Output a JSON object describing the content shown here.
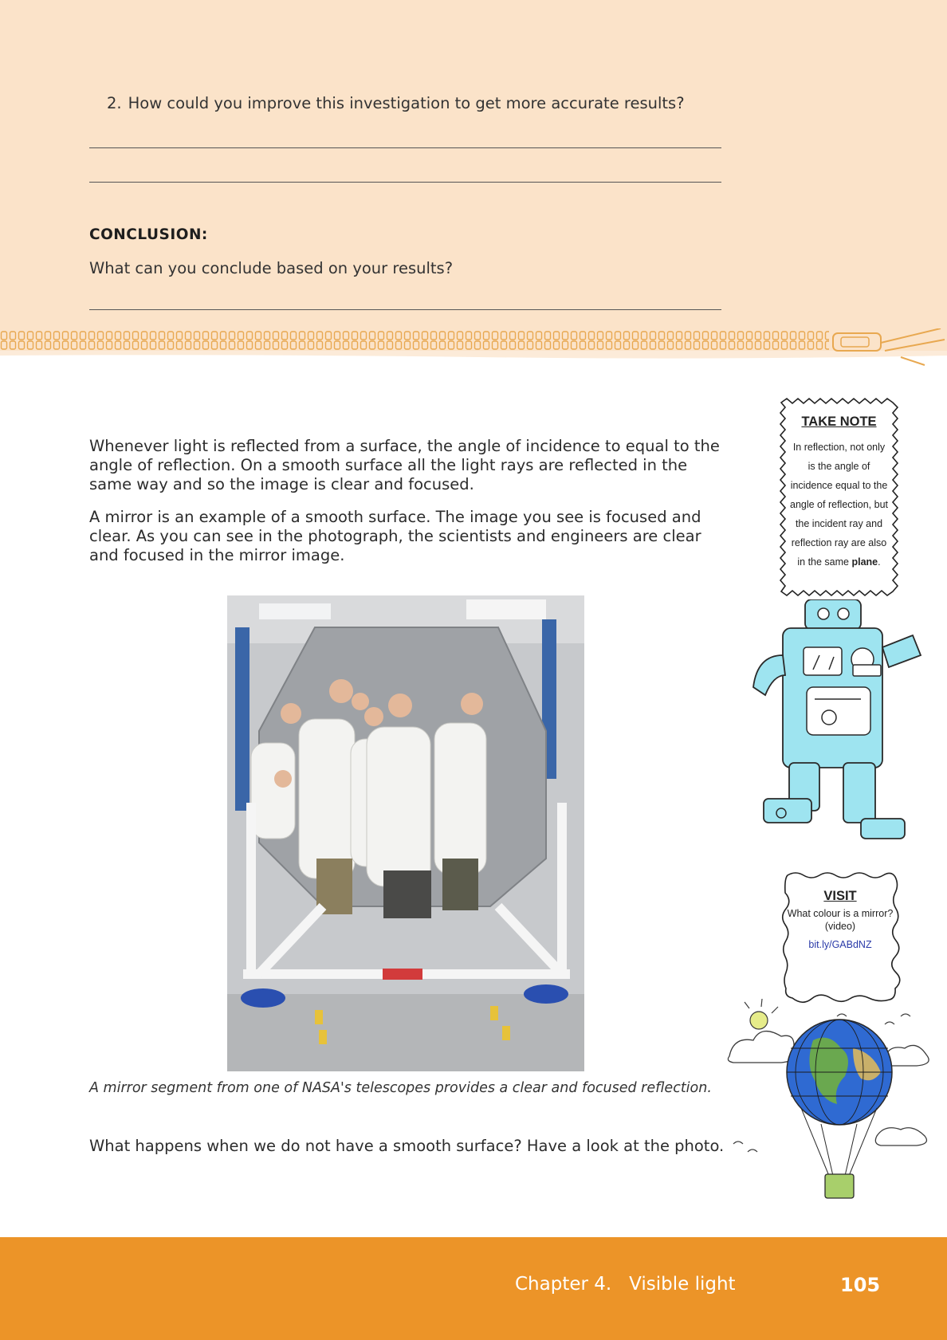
{
  "question": {
    "number": "2.",
    "text": "How could you improve this investigation to get more accurate results?"
  },
  "conclusion": {
    "heading": "CONCLUSION:",
    "prompt": "What can you conclude based on your results?"
  },
  "body": {
    "paragraph1": "Whenever light is reflected from a surface, the angle of incidence to equal to the angle of reflection. On a smooth surface all the light rays are reflected in the same way and so the image is clear and focused.",
    "paragraph2": "A mirror is an example of a smooth surface. The image you see is focused and clear. As you can see in the photograph, the scientists and engineers are clear and focused in the mirror image.",
    "caption": "A mirror segment from one of NASA's telescopes provides a clear and focused reflection.",
    "paragraph3": "What happens when we do not have a smooth surface? Have a look at the photo."
  },
  "take_note": {
    "title": "TAKE NOTE",
    "text_before": "In reflection, not only is the angle of incidence equal to the angle of reflection, but the incident ray and reflection ray are also in the same ",
    "bold_word": "plane",
    "text_after": "."
  },
  "visit": {
    "title": "VISIT",
    "text": "What colour is a mirror? (video)",
    "link": "bit.ly/GABdNZ"
  },
  "footer": {
    "chapter": "Chapter 4.   Visible light",
    "page_number": "105"
  },
  "colors": {
    "peach": "#fbe3c9",
    "orange": "#ec9428",
    "link": "#2a3aa8"
  }
}
